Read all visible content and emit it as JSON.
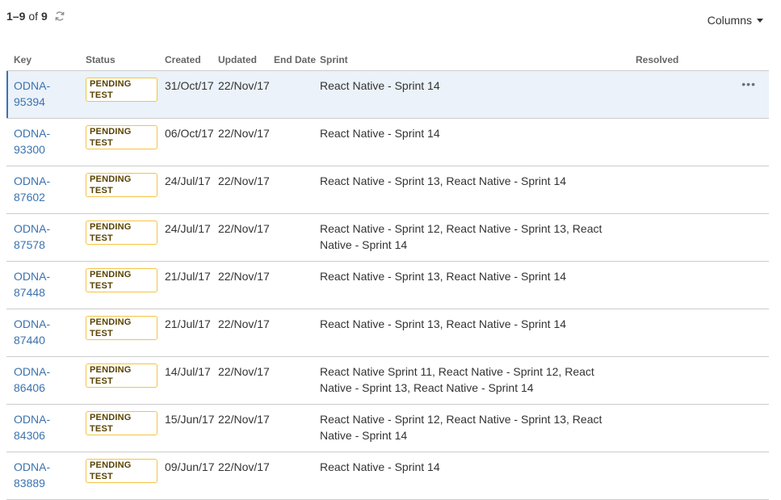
{
  "pager": {
    "range": "1–9",
    "of": "of",
    "total": "9"
  },
  "columns_button": {
    "label": "Columns"
  },
  "table": {
    "headers": {
      "key": "Key",
      "status": "Status",
      "created": "Created",
      "updated": "Updated",
      "end_date": "End Date",
      "sprint": "Sprint",
      "resolved": "Resolved"
    },
    "rows": [
      {
        "key": "ODNA-95394",
        "status": "PENDING TEST",
        "created": "31/Oct/17",
        "updated": "22/Nov/17",
        "end_date": "",
        "sprint": "React Native - Sprint 14",
        "resolved": ""
      },
      {
        "key": "ODNA-93300",
        "status": "PENDING TEST",
        "created": "06/Oct/17",
        "updated": "22/Nov/17",
        "end_date": "",
        "sprint": "React Native - Sprint 14",
        "resolved": ""
      },
      {
        "key": "ODNA-87602",
        "status": "PENDING TEST",
        "created": "24/Jul/17",
        "updated": "22/Nov/17",
        "end_date": "",
        "sprint": "React Native - Sprint 13, React Native - Sprint 14",
        "resolved": ""
      },
      {
        "key": "ODNA-87578",
        "status": "PENDING TEST",
        "created": "24/Jul/17",
        "updated": "22/Nov/17",
        "end_date": "",
        "sprint": "React Native - Sprint 12, React Native - Sprint 13, React Native - Sprint 14",
        "resolved": ""
      },
      {
        "key": "ODNA-87448",
        "status": "PENDING TEST",
        "created": "21/Jul/17",
        "updated": "22/Nov/17",
        "end_date": "",
        "sprint": "React Native - Sprint 13, React Native - Sprint 14",
        "resolved": ""
      },
      {
        "key": "ODNA-87440",
        "status": "PENDING TEST",
        "created": "21/Jul/17",
        "updated": "22/Nov/17",
        "end_date": "",
        "sprint": "React Native - Sprint 13, React Native - Sprint 14",
        "resolved": ""
      },
      {
        "key": "ODNA-86406",
        "status": "PENDING TEST",
        "created": "14/Jul/17",
        "updated": "22/Nov/17",
        "end_date": "",
        "sprint": "React Native Sprint 11, React Native - Sprint 12, React Native - Sprint 13, React Native - Sprint 14",
        "resolved": ""
      },
      {
        "key": "ODNA-84306",
        "status": "PENDING TEST",
        "created": "15/Jun/17",
        "updated": "22/Nov/17",
        "end_date": "",
        "sprint": "React Native - Sprint 12, React Native - Sprint 13, React Native - Sprint 14",
        "resolved": ""
      },
      {
        "key": "ODNA-83889",
        "status": "PENDING TEST",
        "created": "09/Jun/17",
        "updated": "22/Nov/17",
        "end_date": "",
        "sprint": "React Native - Sprint 14",
        "resolved": ""
      }
    ],
    "selected_row": 0,
    "row_actions_icon": "more-horizontal-icon"
  },
  "icons": {
    "refresh": "refresh-icon",
    "columns_caret": "caret-down-icon"
  },
  "colors": {
    "link": "#3b73af",
    "status_border": "#f6c342",
    "status_text": "#594300",
    "selected_row_bg": "#ebf2f9"
  }
}
